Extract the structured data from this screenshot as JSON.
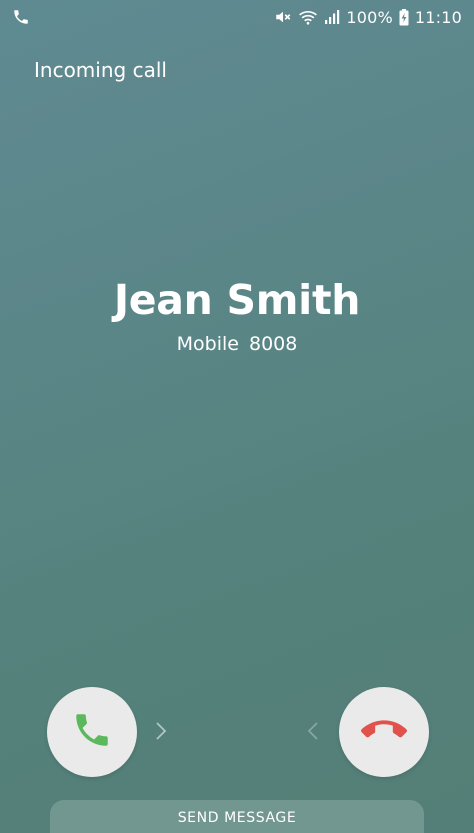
{
  "status_bar": {
    "battery_percent": "100%",
    "time": "11:10",
    "icons": [
      "call-icon",
      "mute-icon",
      "wifi-icon",
      "signal-icon",
      "battery-charging-icon"
    ]
  },
  "call": {
    "status_text": "Incoming call",
    "caller_name": "Jean Smith",
    "number_type": "Mobile",
    "number": "8008"
  },
  "actions": {
    "answer_icon": "phone-answer-icon",
    "decline_icon": "phone-decline-icon",
    "answer_color": "#5cb85c",
    "decline_color": "#e0524b",
    "send_message_label": "SEND MESSAGE"
  },
  "colors": {
    "background": "#5b8688",
    "button_background": "#eaeaea",
    "text": "#ffffff"
  }
}
